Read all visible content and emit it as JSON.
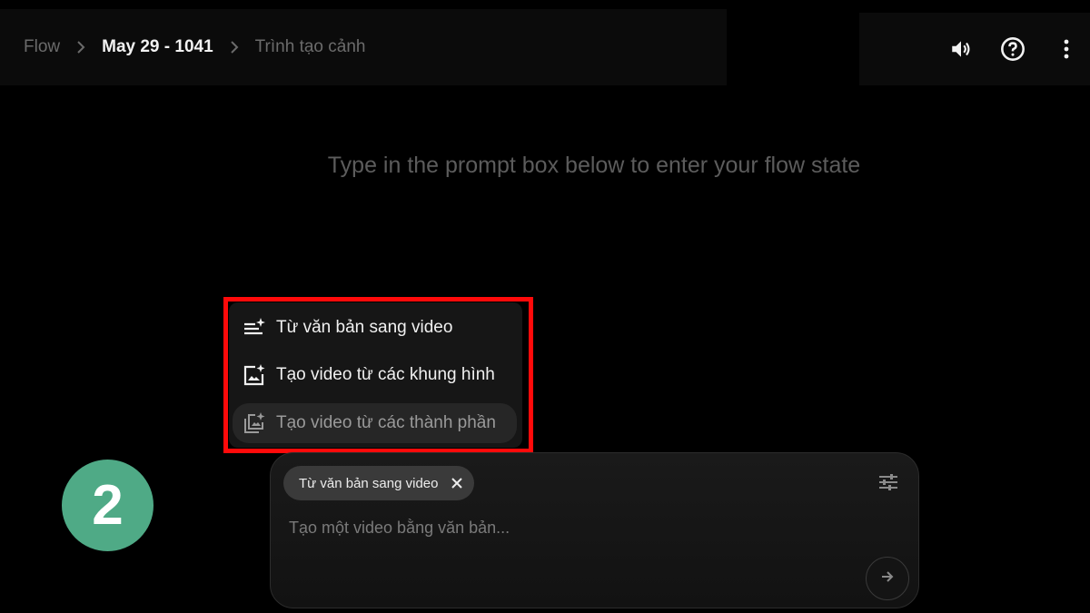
{
  "breadcrumb": {
    "root": "Flow",
    "project": "May 29 - 1041",
    "current": "Trình tạo cảnh"
  },
  "header_icons": [
    "volume-icon",
    "help-icon",
    "more-vert-icon"
  ],
  "hint_text": "Type in the prompt box below to enter your flow state",
  "mode_menu": {
    "items": [
      {
        "label": "Từ văn bản sang video",
        "icon": "text-sparkle-icon"
      },
      {
        "label": "Tạo video từ các khung hình",
        "icon": "image-sparkle-icon"
      },
      {
        "label": "Tạo video từ các thành phần",
        "icon": "layers-sparkle-icon"
      }
    ],
    "highlight_color": "#ff0a0a"
  },
  "step_badge": "2",
  "composer": {
    "chip_label": "Từ văn bản sang video",
    "placeholder": "Tạo một video bằng văn bản...",
    "value": ""
  },
  "colors": {
    "background": "#000000",
    "badge": "#4faa86",
    "highlight": "#ff0a0a"
  }
}
